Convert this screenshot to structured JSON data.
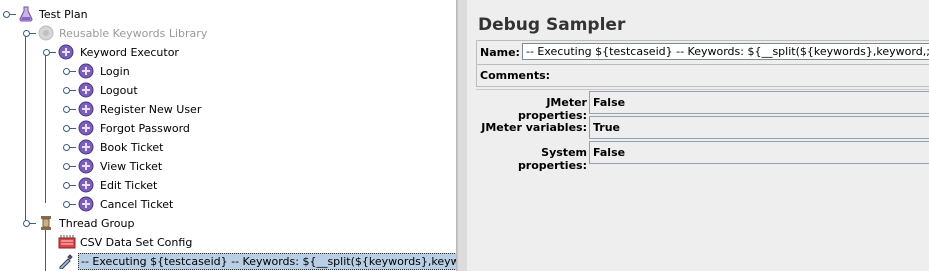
{
  "tree": {
    "test_plan": "Test Plan",
    "reusable_library": "Reusable Keywords Library",
    "keyword_executor": "Keyword Executor",
    "keywords": [
      "Login",
      "Logout",
      "Register New User",
      "Forgot Password",
      "Book Ticket",
      "View Ticket",
      "Edit Ticket",
      "Cancel Ticket"
    ],
    "thread_group": "Thread Group",
    "csv_config": "CSV Data Set Config",
    "selected_sampler": "-- Executing ${testcaseid}  -- Keywords: ${__split(${keywords},keyword,;)}"
  },
  "panel": {
    "title": "Debug Sampler",
    "name_label": "Name:",
    "name_value": "-- Executing ${testcaseid}  -- Keywords: ${__split(${keywords},keyword,;)}",
    "comments_label": "Comments:",
    "properties": [
      {
        "label": "JMeter properties:",
        "value": "False"
      },
      {
        "label": "JMeter variables:",
        "value": "True"
      },
      {
        "label": "System properties:",
        "value": "False"
      }
    ]
  },
  "colors": {
    "selection": "#b8cfe5",
    "tree_lines": "#3c5f84",
    "sampler_purple": "#6a4fa3"
  }
}
